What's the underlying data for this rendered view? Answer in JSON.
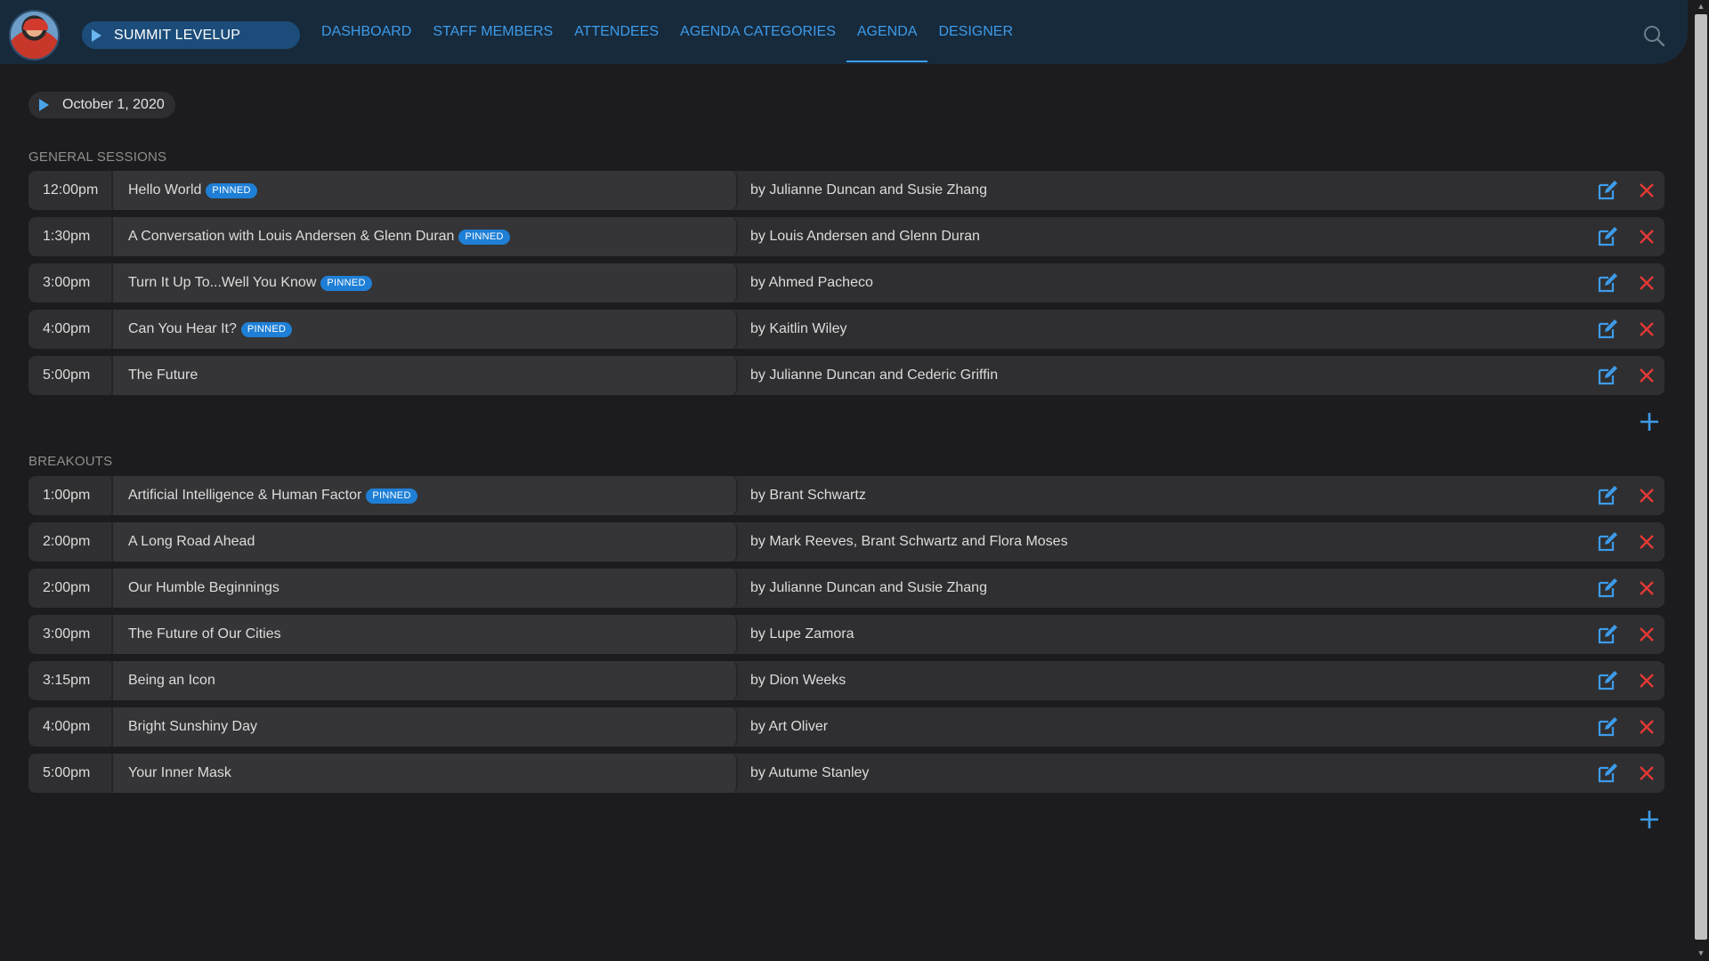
{
  "colors": {
    "accent": "#3d9be9",
    "delete": "#e53935",
    "badge": "#1f7fd6"
  },
  "header": {
    "event_name": "SUMMIT LEVELUP",
    "nav": [
      {
        "label": "DASHBOARD",
        "active": false
      },
      {
        "label": "STAFF MEMBERS",
        "active": false
      },
      {
        "label": "ATTENDEES",
        "active": false
      },
      {
        "label": "AGENDA CATEGORIES",
        "active": false
      },
      {
        "label": "AGENDA",
        "active": true
      },
      {
        "label": "DESIGNER",
        "active": false
      }
    ],
    "icons": [
      "avatar",
      "play-icon",
      "search-icon"
    ]
  },
  "date": {
    "label": "October 1, 2020"
  },
  "sections": [
    {
      "title": "GENERAL SESSIONS",
      "items": [
        {
          "time": "12:00pm",
          "title": "Hello World",
          "pinned": true,
          "speakers": "by Julianne Duncan and Susie Zhang"
        },
        {
          "time": "1:30pm",
          "title": "A Conversation with Louis Andersen & Glenn Duran",
          "pinned": true,
          "speakers": "by Louis Andersen and Glenn Duran"
        },
        {
          "time": "3:00pm",
          "title": "Turn It Up To...Well You Know",
          "pinned": true,
          "speakers": "by Ahmed Pacheco"
        },
        {
          "time": "4:00pm",
          "title": "Can You Hear It?",
          "pinned": true,
          "speakers": "by Kaitlin Wiley"
        },
        {
          "time": "5:00pm",
          "title": "The Future",
          "pinned": false,
          "speakers": "by Julianne Duncan and Cederic Griffin"
        }
      ]
    },
    {
      "title": "BREAKOUTS",
      "items": [
        {
          "time": "1:00pm",
          "title": "Artificial Intelligence & Human Factor",
          "pinned": true,
          "speakers": "by Brant Schwartz"
        },
        {
          "time": "2:00pm",
          "title": "A Long Road Ahead",
          "pinned": false,
          "speakers": "by Mark Reeves, Brant Schwartz and Flora Moses"
        },
        {
          "time": "2:00pm",
          "title": "Our Humble Beginnings",
          "pinned": false,
          "speakers": "by Julianne Duncan and Susie Zhang"
        },
        {
          "time": "3:00pm",
          "title": "The Future of Our Cities",
          "pinned": false,
          "speakers": "by Lupe Zamora"
        },
        {
          "time": "3:15pm",
          "title": "Being an Icon",
          "pinned": false,
          "speakers": "by Dion Weeks"
        },
        {
          "time": "4:00pm",
          "title": "Bright Sunshiny Day",
          "pinned": false,
          "speakers": "by Art Oliver"
        },
        {
          "time": "5:00pm",
          "title": "Your Inner Mask",
          "pinned": false,
          "speakers": "by Autume Stanley"
        }
      ]
    }
  ],
  "badge_label": "PINNED"
}
